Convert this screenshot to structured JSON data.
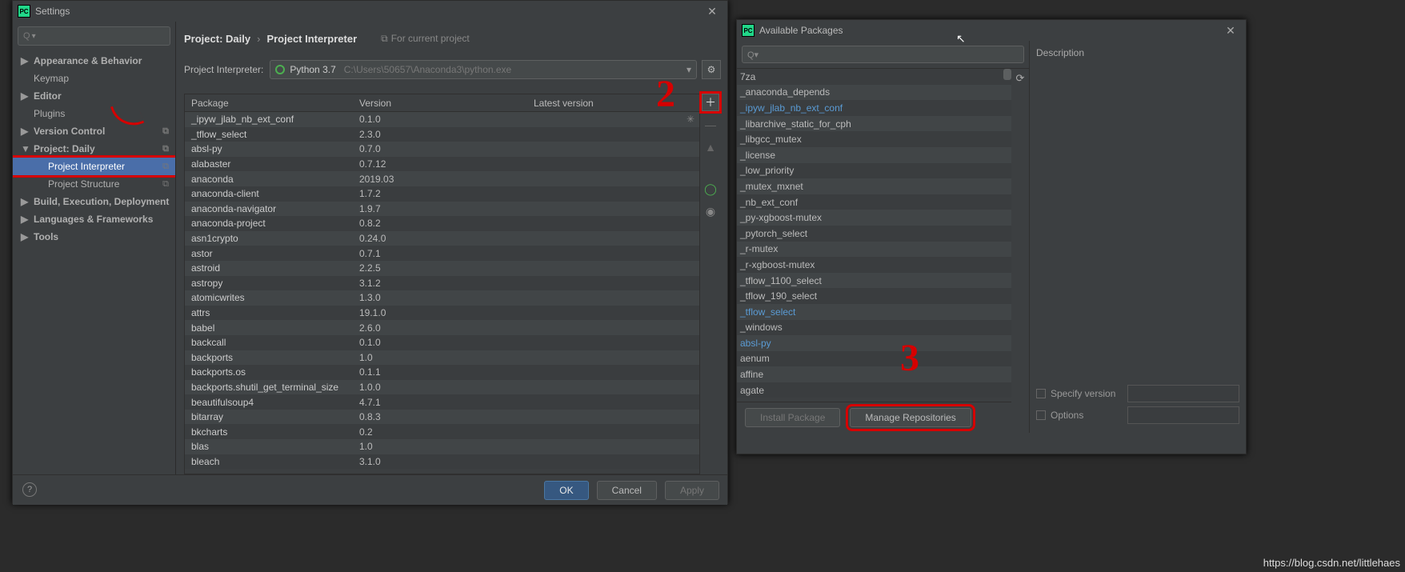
{
  "settings": {
    "title": "Settings",
    "search_placeholder": "Q▾",
    "sidebar": [
      {
        "label": "Appearance & Behavior",
        "chev": "▶",
        "bold": true
      },
      {
        "label": "Keymap",
        "chev": "",
        "bold": false
      },
      {
        "label": "Editor",
        "chev": "▶",
        "bold": true
      },
      {
        "label": "Plugins",
        "chev": "",
        "bold": false
      },
      {
        "label": "Version Control",
        "chev": "▶",
        "bold": true,
        "tail": "⧉"
      },
      {
        "label": "Project: Daily",
        "chev": "▼",
        "bold": true,
        "tail": "⧉"
      },
      {
        "label": "Project Interpreter",
        "chev": "",
        "bold": false,
        "l1": true,
        "sel": true,
        "tail": "⧉"
      },
      {
        "label": "Project Structure",
        "chev": "",
        "bold": false,
        "l1": true,
        "tail": "⧉"
      },
      {
        "label": "Build, Execution, Deployment",
        "chev": "▶",
        "bold": true
      },
      {
        "label": "Languages & Frameworks",
        "chev": "▶",
        "bold": true
      },
      {
        "label": "Tools",
        "chev": "▶",
        "bold": true
      }
    ],
    "crumb_project": "Project: Daily",
    "crumb_page": "Project Interpreter",
    "crumb_note": "For current project",
    "interp_label": "Project Interpreter:",
    "interp_name": "Python 3.7",
    "interp_path": "C:\\Users\\50657\\Anaconda3\\python.exe",
    "cols": {
      "package": "Package",
      "version": "Version",
      "latest": "Latest version"
    },
    "packages": [
      {
        "n": "_ipyw_jlab_nb_ext_conf",
        "v": "0.1.0"
      },
      {
        "n": "_tflow_select",
        "v": "2.3.0"
      },
      {
        "n": "absl-py",
        "v": "0.7.0"
      },
      {
        "n": "alabaster",
        "v": "0.7.12"
      },
      {
        "n": "anaconda",
        "v": "2019.03"
      },
      {
        "n": "anaconda-client",
        "v": "1.7.2"
      },
      {
        "n": "anaconda-navigator",
        "v": "1.9.7"
      },
      {
        "n": "anaconda-project",
        "v": "0.8.2"
      },
      {
        "n": "asn1crypto",
        "v": "0.24.0"
      },
      {
        "n": "astor",
        "v": "0.7.1"
      },
      {
        "n": "astroid",
        "v": "2.2.5"
      },
      {
        "n": "astropy",
        "v": "3.1.2"
      },
      {
        "n": "atomicwrites",
        "v": "1.3.0"
      },
      {
        "n": "attrs",
        "v": "19.1.0"
      },
      {
        "n": "babel",
        "v": "2.6.0"
      },
      {
        "n": "backcall",
        "v": "0.1.0"
      },
      {
        "n": "backports",
        "v": "1.0"
      },
      {
        "n": "backports.os",
        "v": "0.1.1"
      },
      {
        "n": "backports.shutil_get_terminal_size",
        "v": "1.0.0"
      },
      {
        "n": "beautifulsoup4",
        "v": "4.7.1"
      },
      {
        "n": "bitarray",
        "v": "0.8.3"
      },
      {
        "n": "bkcharts",
        "v": "0.2"
      },
      {
        "n": "blas",
        "v": "1.0"
      },
      {
        "n": "bleach",
        "v": "3.1.0"
      }
    ],
    "buttons": {
      "ok": "OK",
      "cancel": "Cancel",
      "apply": "Apply"
    }
  },
  "avail": {
    "title": "Available Packages",
    "search_placeholder": "Q▾",
    "list": [
      {
        "n": "7za"
      },
      {
        "n": "_anaconda_depends"
      },
      {
        "n": "_ipyw_jlab_nb_ext_conf",
        "sel": true
      },
      {
        "n": "_libarchive_static_for_cph"
      },
      {
        "n": "_libgcc_mutex"
      },
      {
        "n": "_license"
      },
      {
        "n": "_low_priority"
      },
      {
        "n": "_mutex_mxnet"
      },
      {
        "n": "_nb_ext_conf"
      },
      {
        "n": "_py-xgboost-mutex"
      },
      {
        "n": "_pytorch_select"
      },
      {
        "n": "_r-mutex"
      },
      {
        "n": "_r-xgboost-mutex"
      },
      {
        "n": "_tflow_1100_select"
      },
      {
        "n": "_tflow_190_select"
      },
      {
        "n": "_tflow_select",
        "sel": true
      },
      {
        "n": "_windows"
      },
      {
        "n": "absl-py",
        "sel": true
      },
      {
        "n": "aenum"
      },
      {
        "n": "affine"
      },
      {
        "n": "agate"
      }
    ],
    "desc_label": "Description",
    "spec_label": "Specify version",
    "opt_label": "Options",
    "install": "Install Package",
    "manage": "Manage Repositories"
  },
  "annotations": {
    "two": "2",
    "three": "3"
  },
  "watermark": "https://blog.csdn.net/littlehaes"
}
